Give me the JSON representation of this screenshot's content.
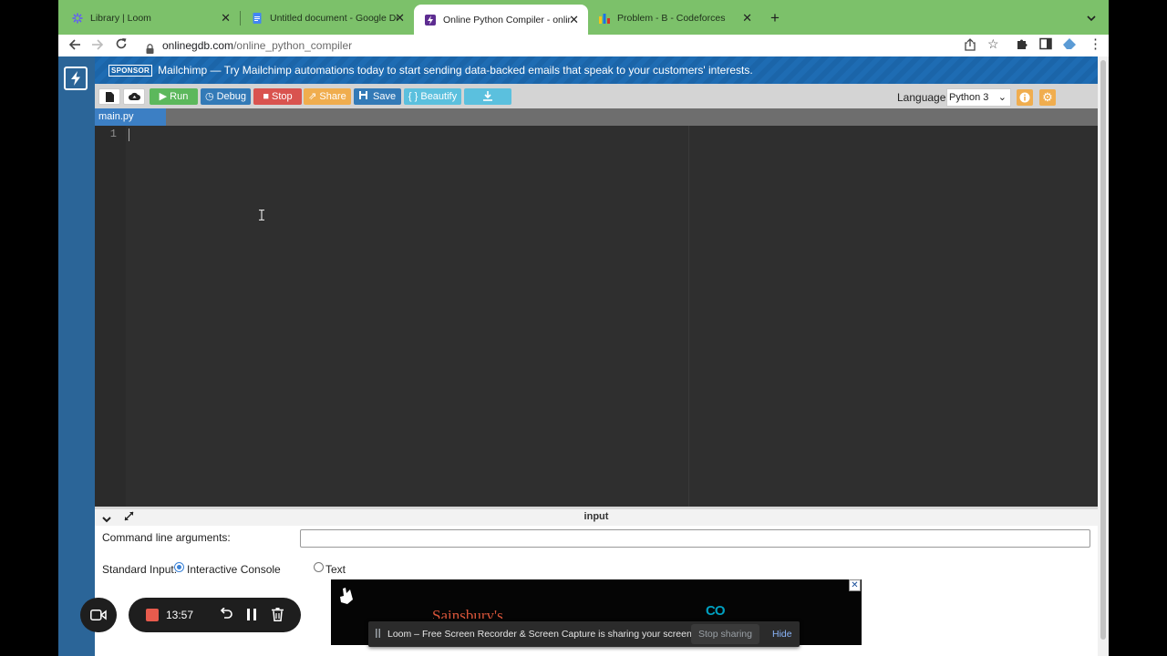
{
  "browser": {
    "tabs": [
      {
        "title": "Library | Loom",
        "active": false
      },
      {
        "title": "Untitled document - Google Docs",
        "active": false
      },
      {
        "title": "Online Python Compiler - online editor",
        "active": true
      },
      {
        "title": "Problem - B - Codeforces",
        "active": false
      }
    ],
    "url_domain": "onlinegdb.com",
    "url_path": "/online_python_compiler"
  },
  "sponsor": {
    "badge": "SPONSOR",
    "text": "Mailchimp — Try Mailchimp automations today to start sending data-backed emails that speak to your customers' interests."
  },
  "toolbar": {
    "run": "Run",
    "debug": "Debug",
    "stop": "Stop",
    "share": "Share",
    "save": "Save",
    "beautify": "{ } Beautify",
    "language_label": "Language",
    "language_value": "Python 3"
  },
  "editor": {
    "file_tab": "main.py",
    "line_numbers": [
      "1"
    ]
  },
  "input_panel": {
    "title": "input",
    "cmd_args_label": "Command line arguments:",
    "cmd_args_value": "",
    "stdin_label": "Standard Input:",
    "option_interactive": "Interactive Console",
    "option_text": "Text",
    "selected": "Interactive Console"
  },
  "loom": {
    "timer": "13:57"
  },
  "ad": {
    "text": "Sainsbury's",
    "logo_text": "CO"
  },
  "screen_share": {
    "message": "Loom – Free Screen Recorder & Screen Capture is sharing your screen.",
    "stop_label": "Stop sharing",
    "hide_label": "Hide"
  },
  "colors": {
    "tabstrip": "#7cc16a",
    "sidebar": "#2b6598",
    "editor_bg": "#2f2f2f",
    "run": "#5cb85c",
    "debug": "#337ab7",
    "stop": "#d9534f",
    "share": "#f0ad4e",
    "save": "#337ab7",
    "beautify": "#5bc0de"
  }
}
